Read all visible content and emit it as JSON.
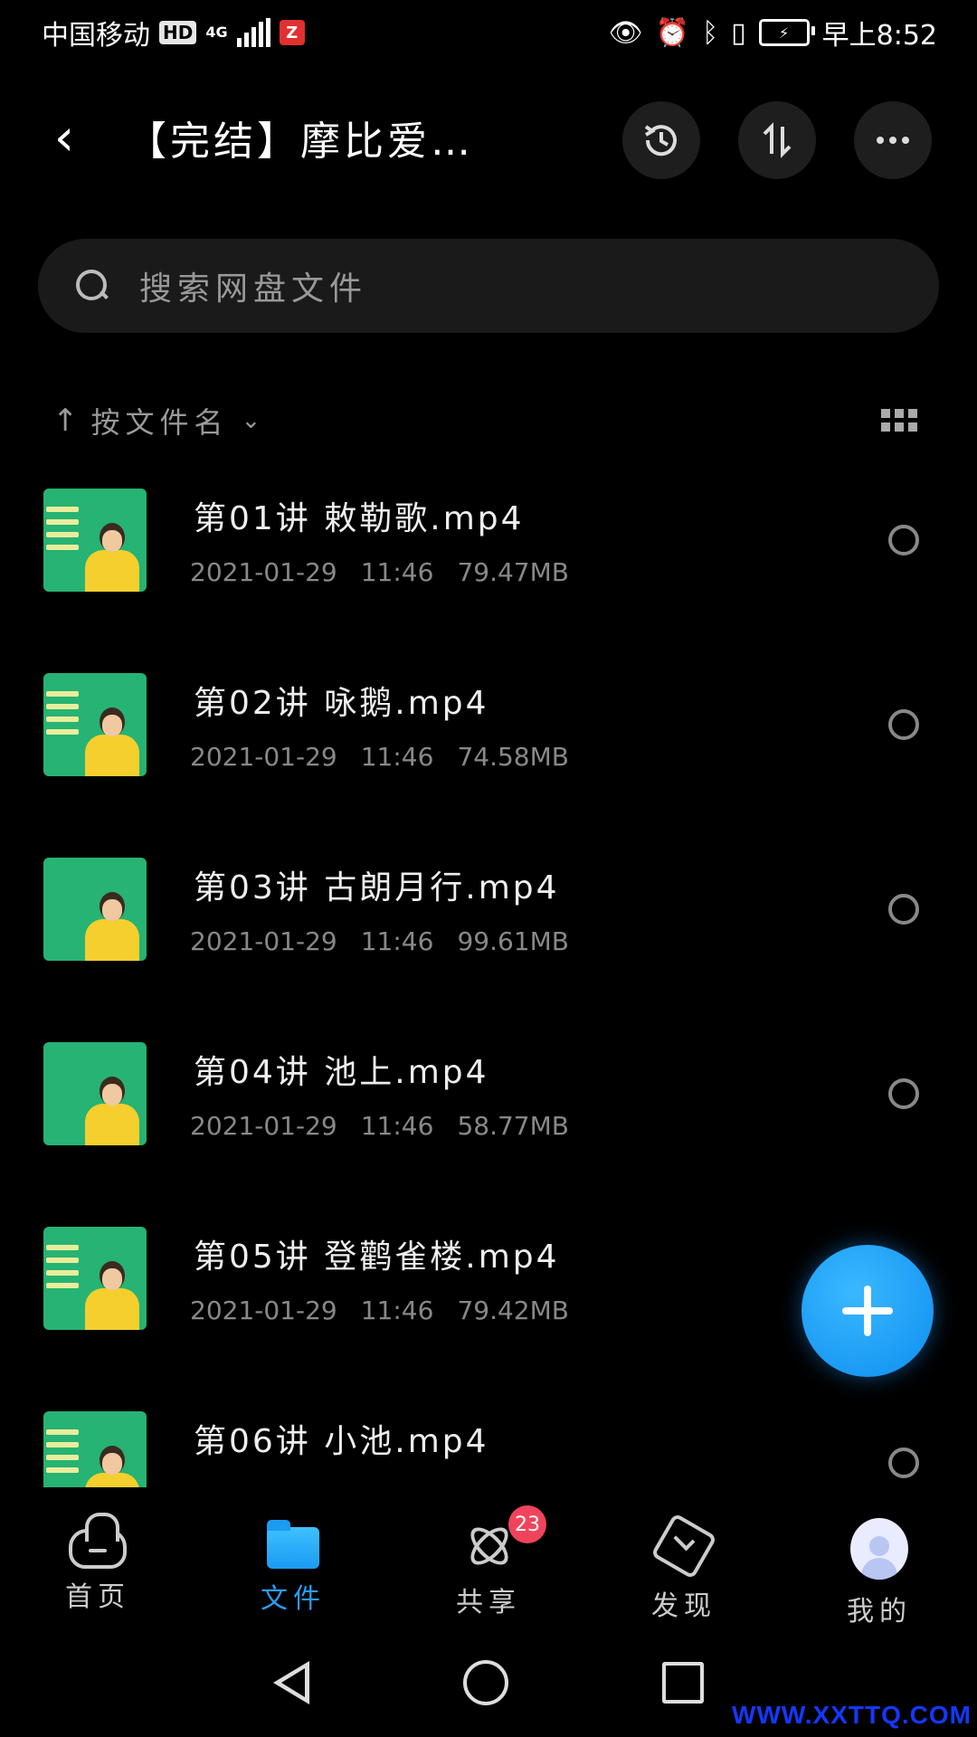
{
  "status_bar": {
    "carrier": "中国移动",
    "hd": "HD",
    "network": "4G",
    "app_badge": "Z",
    "time": "早上8:52"
  },
  "header": {
    "title": "【完结】摩比爱…",
    "back_icon": "chevron-left-icon",
    "actions": [
      "history-icon",
      "transfer-icon",
      "more-icon"
    ]
  },
  "search": {
    "placeholder": "搜索网盘文件"
  },
  "sort": {
    "label": "按文件名"
  },
  "files": [
    {
      "name": "第01讲 敕勒歌.mp4",
      "date": "2021-01-29",
      "time": "11:46",
      "size": "79.47MB"
    },
    {
      "name": "第02讲 咏鹅.mp4",
      "date": "2021-01-29",
      "time": "11:46",
      "size": "74.58MB"
    },
    {
      "name": "第03讲 古朗月行.mp4",
      "date": "2021-01-29",
      "time": "11:46",
      "size": "99.61MB"
    },
    {
      "name": "第04讲 池上.mp4",
      "date": "2021-01-29",
      "time": "11:46",
      "size": "58.77MB"
    },
    {
      "name": "第05讲 登鹳雀楼.mp4",
      "date": "2021-01-29",
      "time": "11:46",
      "size": "79.42MB"
    },
    {
      "name": "第06讲 小池.mp4",
      "date": "",
      "time": "",
      "size": ""
    }
  ],
  "bottom_nav": {
    "items": [
      {
        "label": "首页",
        "icon": "cloud-icon"
      },
      {
        "label": "文件",
        "icon": "folder-icon",
        "active": true
      },
      {
        "label": "共享",
        "icon": "share-atom-icon",
        "badge": "23"
      },
      {
        "label": "发现",
        "icon": "discover-cube-icon"
      },
      {
        "label": "我的",
        "icon": "avatar-icon"
      }
    ]
  },
  "colors": {
    "accent": "#2a9cf5",
    "thumb_green": "#26b373",
    "badge_red": "#f0445c"
  },
  "watermark": "WWW.XXTTQ.COM"
}
